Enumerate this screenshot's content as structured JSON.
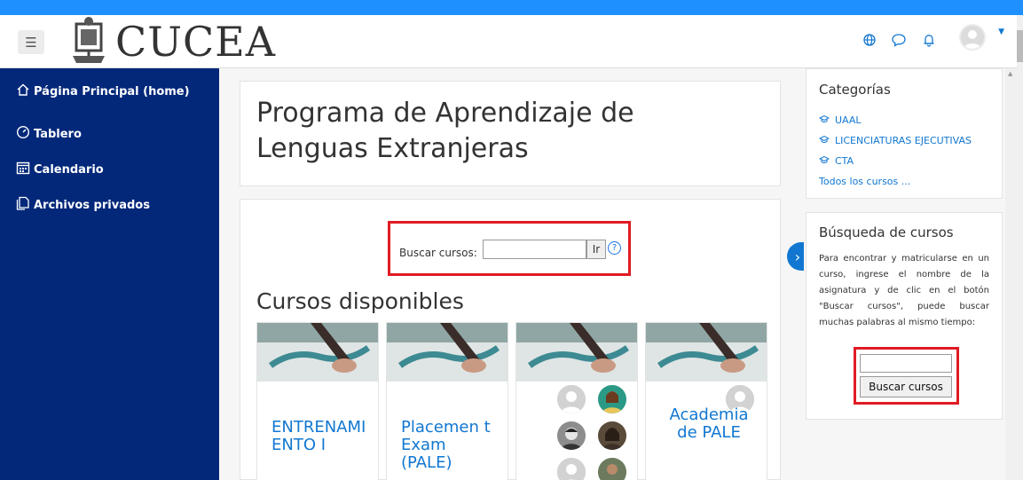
{
  "header": {
    "brand": "CUCEA",
    "menu_icon": "hamburger-icon",
    "icons": [
      "globe-icon",
      "chat-bubble-icon",
      "bell-icon",
      "user-avatar",
      "caret-down-icon"
    ]
  },
  "sidebar": {
    "items": [
      {
        "label": "Página Principal (home)",
        "icon": "home-icon"
      },
      {
        "label": "Tablero",
        "icon": "dashboard-icon"
      },
      {
        "label": "Calendario",
        "icon": "calendar-icon"
      },
      {
        "label": "Archivos privados",
        "icon": "files-icon"
      }
    ]
  },
  "main": {
    "page_title": "Programa de Aprendizaje de Lenguas Extranjeras",
    "search": {
      "label": "Buscar cursos:",
      "button": "Ir",
      "help": "?"
    },
    "section_title": "Cursos disponibles",
    "courses": [
      {
        "name": "ENTRENAMI ENTO I"
      },
      {
        "name": "Placemen t Exam (PALE)"
      },
      {
        "name": ""
      },
      {
        "name": "Academia de PALE"
      }
    ]
  },
  "right": {
    "categories": {
      "title": "Categorías",
      "items": [
        "UAAL",
        "LICENCIATURAS EJECUTIVAS",
        "CTA"
      ],
      "all_link": "Todos los cursos ..."
    },
    "course_search": {
      "title": "Búsqueda de cursos",
      "description": "Para encontrar y matricularse en un curso, ingrese el nombre de la asignatura y de clic en el botón \"Buscar cursos\", puede buscar muchas palabras al mismo tiempo:",
      "button": "Buscar cursos"
    }
  },
  "colors": {
    "sidebar_bg": "#03287a",
    "link": "#1177d1",
    "highlight_box": "#e01b24",
    "window_frame": "#1e90ff"
  }
}
